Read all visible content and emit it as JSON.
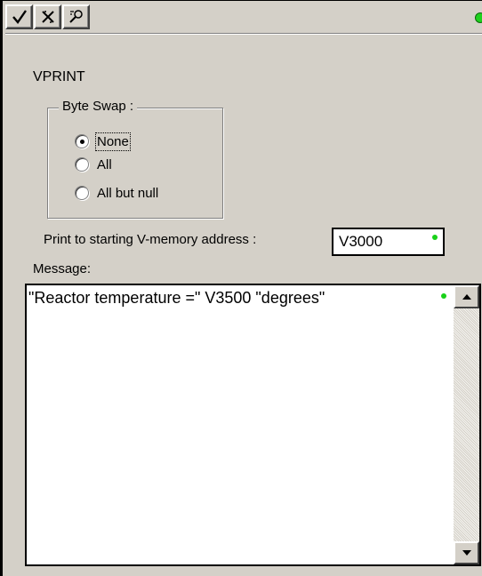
{
  "toolbar": {
    "buttons": [
      {
        "icon": "checkmark-icon",
        "glyph": "✓"
      },
      {
        "icon": "cancel-x-icon",
        "glyph": "✗"
      },
      {
        "icon": "find-icon",
        "glyph": "⌕"
      }
    ],
    "status_color": "#1fd11f"
  },
  "instruction": {
    "title": "VPRINT"
  },
  "byte_swap": {
    "label": "Byte Swap :",
    "options": [
      {
        "label": "None",
        "selected": true
      },
      {
        "label": "All",
        "selected": false
      },
      {
        "label": "All but null",
        "selected": false
      }
    ]
  },
  "address": {
    "label": "Print to starting V-memory address :",
    "value": "V3000"
  },
  "message": {
    "label": "Message:",
    "value": "\"Reactor temperature =\" V3500 \"degrees\""
  },
  "colors": {
    "valid_dot": "#19d119",
    "background": "#d4d0c8"
  }
}
